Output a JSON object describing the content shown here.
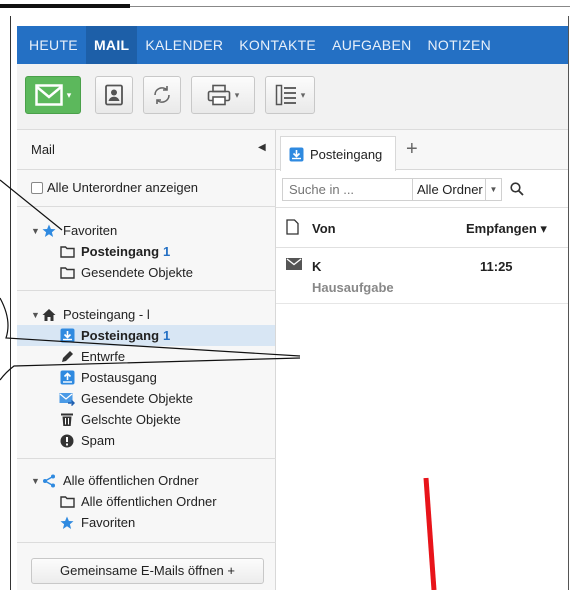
{
  "nav": {
    "items": [
      "HEUTE",
      "MAIL",
      "KALENDER",
      "KONTAKTE",
      "AUFGABEN",
      "NOTIZEN"
    ],
    "active": "MAIL"
  },
  "toolbar": {
    "buttons": [
      "new-mail-icon",
      "contacts-icon",
      "refresh-icon",
      "print-icon",
      "layout-icon"
    ]
  },
  "sidebar": {
    "title": "Mail",
    "show_subfolders": "Alle Unterordner anzeigen",
    "favorites": {
      "label": "Favoriten",
      "inbox": "Posteingang",
      "inbox_count": "1",
      "sent": "Gesendete Objekte"
    },
    "mailbox": {
      "label": "Posteingang - l",
      "inbox": "Posteingang",
      "inbox_count": "1",
      "drafts": "Entwrfe",
      "outbox": "Postausgang",
      "sent": "Gesendete Objekte",
      "deleted": "Gelschte Objekte",
      "spam": "Spam"
    },
    "public": {
      "label": "Alle öffentlichen Ordner",
      "all": "Alle öffentlichen Ordner",
      "favorites": "Favoriten"
    },
    "shared_button": "Gemeinsame E-Mails öffnen +"
  },
  "main": {
    "tab_label": "Posteingang",
    "search_placeholder": "Suche in ...",
    "folder_select": "Alle Ordner",
    "col_from": "Von",
    "col_sort": "Empfangen ▾",
    "mails": [
      {
        "sender": "K",
        "time": "11:25",
        "subject": "Hausaufgabe"
      }
    ]
  },
  "colors": {
    "nav_bg": "#2470c4",
    "accent": "#2470c4",
    "new_mail_green": "#5cb85c",
    "annotation_red": "#e8141a"
  }
}
